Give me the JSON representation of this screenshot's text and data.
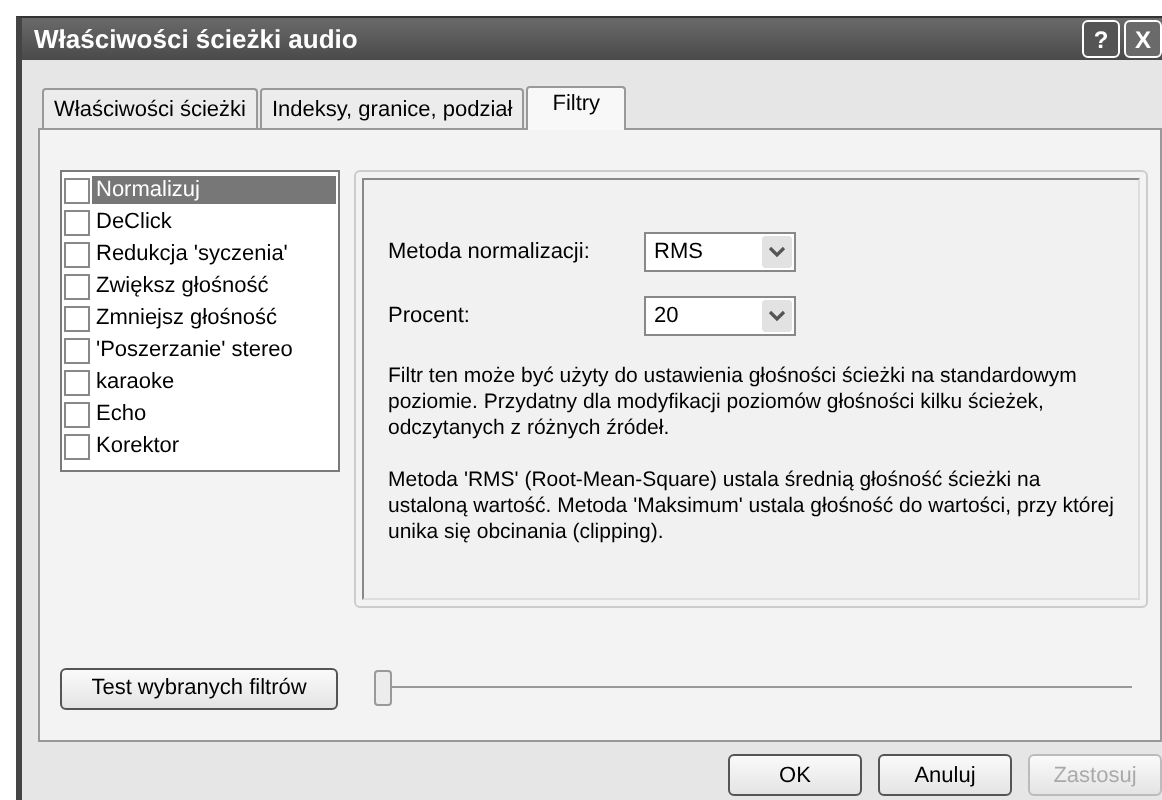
{
  "window": {
    "title": "Właściwości ścieżki audio"
  },
  "title_buttons": [
    {
      "kind": "help",
      "label": "?"
    },
    {
      "kind": "close",
      "label": "X"
    }
  ],
  "tabs": [
    {
      "label": "Właściwości ścieżki",
      "selected": false
    },
    {
      "label": "Indeksy, granice, podział",
      "selected": false
    },
    {
      "label": "Filtry",
      "selected": true
    }
  ],
  "filters": [
    {
      "label": "Normalizuj",
      "checked": false,
      "selected": true
    },
    {
      "label": "DeClick",
      "checked": false,
      "selected": false
    },
    {
      "label": "Redukcja 'syczenia'",
      "checked": false,
      "selected": false
    },
    {
      "label": "Zwiększ głośność",
      "checked": false,
      "selected": false
    },
    {
      "label": "Zmniejsz głośność",
      "checked": false,
      "selected": false
    },
    {
      "label": "'Poszerzanie' stereo",
      "checked": false,
      "selected": false
    },
    {
      "label": "karaoke",
      "checked": false,
      "selected": false
    },
    {
      "label": "Echo",
      "checked": false,
      "selected": false
    },
    {
      "label": "Korektor",
      "checked": false,
      "selected": false
    }
  ],
  "settings": [
    {
      "label": "Metoda normalizacji:",
      "value": "RMS"
    },
    {
      "label": "Procent:",
      "value": "20"
    }
  ],
  "description": [
    "Filtr ten może być użyty do ustawienia głośności ścieżki na standardowym poziomie. Przydatny dla modyfikacji poziomów głośności kilku ścieżek, odczytanych z różnych źródeł.",
    "Metoda 'RMS' (Root-Mean-Square) ustala średnią głośność ścieżki na ustaloną wartość. Metoda 'Maksimum' ustala głośność do wartości, przy której unika się obcinania (clipping)."
  ],
  "test_button": "Test wybranych filtrów",
  "slider": {
    "level": 0
  },
  "buttons": [
    {
      "label": "OK",
      "disabled": false
    },
    {
      "label": "Anuluj",
      "disabled": false
    },
    {
      "label": "Zastosuj",
      "disabled": true
    }
  ]
}
